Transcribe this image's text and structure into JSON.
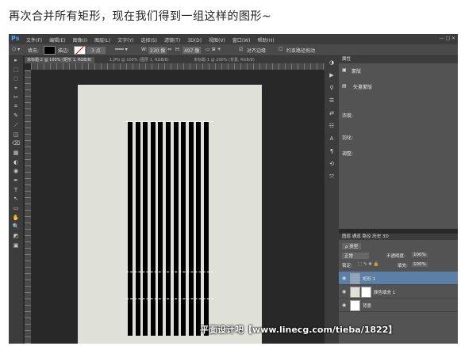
{
  "caption": "再次合并所有矩形，现在我们得到一组这样的图形~",
  "ps": {
    "logo": "Ps",
    "menu": [
      "文件(F)",
      "编辑(E)",
      "图像(I)",
      "图层(L)",
      "文字(Y)",
      "选择(S)",
      "滤镜(T)",
      "3D(D)",
      "视图(V)",
      "窗口(W)",
      "帮助(H)"
    ],
    "window_buttons": "— □ ✕",
    "options": {
      "fill_label": "填充:",
      "stroke_label": "描边:",
      "stroke_width": "3 点",
      "w_label": "W:",
      "w_value": "230 像",
      "link": "⇔",
      "h_label": "H:",
      "h_value": "497 像",
      "align_edges": "对齐边缘",
      "constrain": "约束路径拖动"
    },
    "tabs": [
      "未标题-2 @ 100% (矩形 1, RGB/8)",
      "1.JPG @ 100% (图层 1, RGB/8)",
      "未标题-1 @ 200% (背景, RGB/8)"
    ],
    "tools": [
      "▸",
      "⬚",
      "◌",
      "⌖",
      "✂",
      "⌗",
      "✎",
      "⟋",
      "◫",
      "⌫",
      "▦",
      "◐",
      "◉",
      "✒",
      "T",
      "↖",
      "▭",
      "✋",
      "🔍",
      "◩",
      "▣"
    ],
    "right_icons": [
      "◑",
      "▶",
      "⚲",
      "☰",
      "⇄",
      "☷",
      "A",
      "¶",
      "⟲",
      "⤧"
    ],
    "properties": {
      "tab": "属性",
      "mask_label": "蒙版",
      "vector_mask": "矢量蒙版",
      "density": "浓度:",
      "feather": "羽化:",
      "adjust": "调整:"
    },
    "layers_panel": {
      "tabs": "图层  通道  路径  历史  3D",
      "kind": "ρ 类型",
      "blend": "正常",
      "opacity_label": "不透明度:",
      "opacity": "100%",
      "lock_label": "锁定:",
      "fill_label": "填充:",
      "fill": "100%",
      "layers": [
        {
          "name": "矩形 1",
          "selected": true
        },
        {
          "name": "颜色填充 1",
          "selected": false
        },
        {
          "name": "背景",
          "selected": false
        }
      ]
    },
    "colors": {
      "canvas_bg": "#dfe1d8",
      "stripe": "#000000",
      "accent": "#4aa3ff"
    }
  },
  "watermark": "平面设计吧【www.linecg.com/tieba/1822】"
}
